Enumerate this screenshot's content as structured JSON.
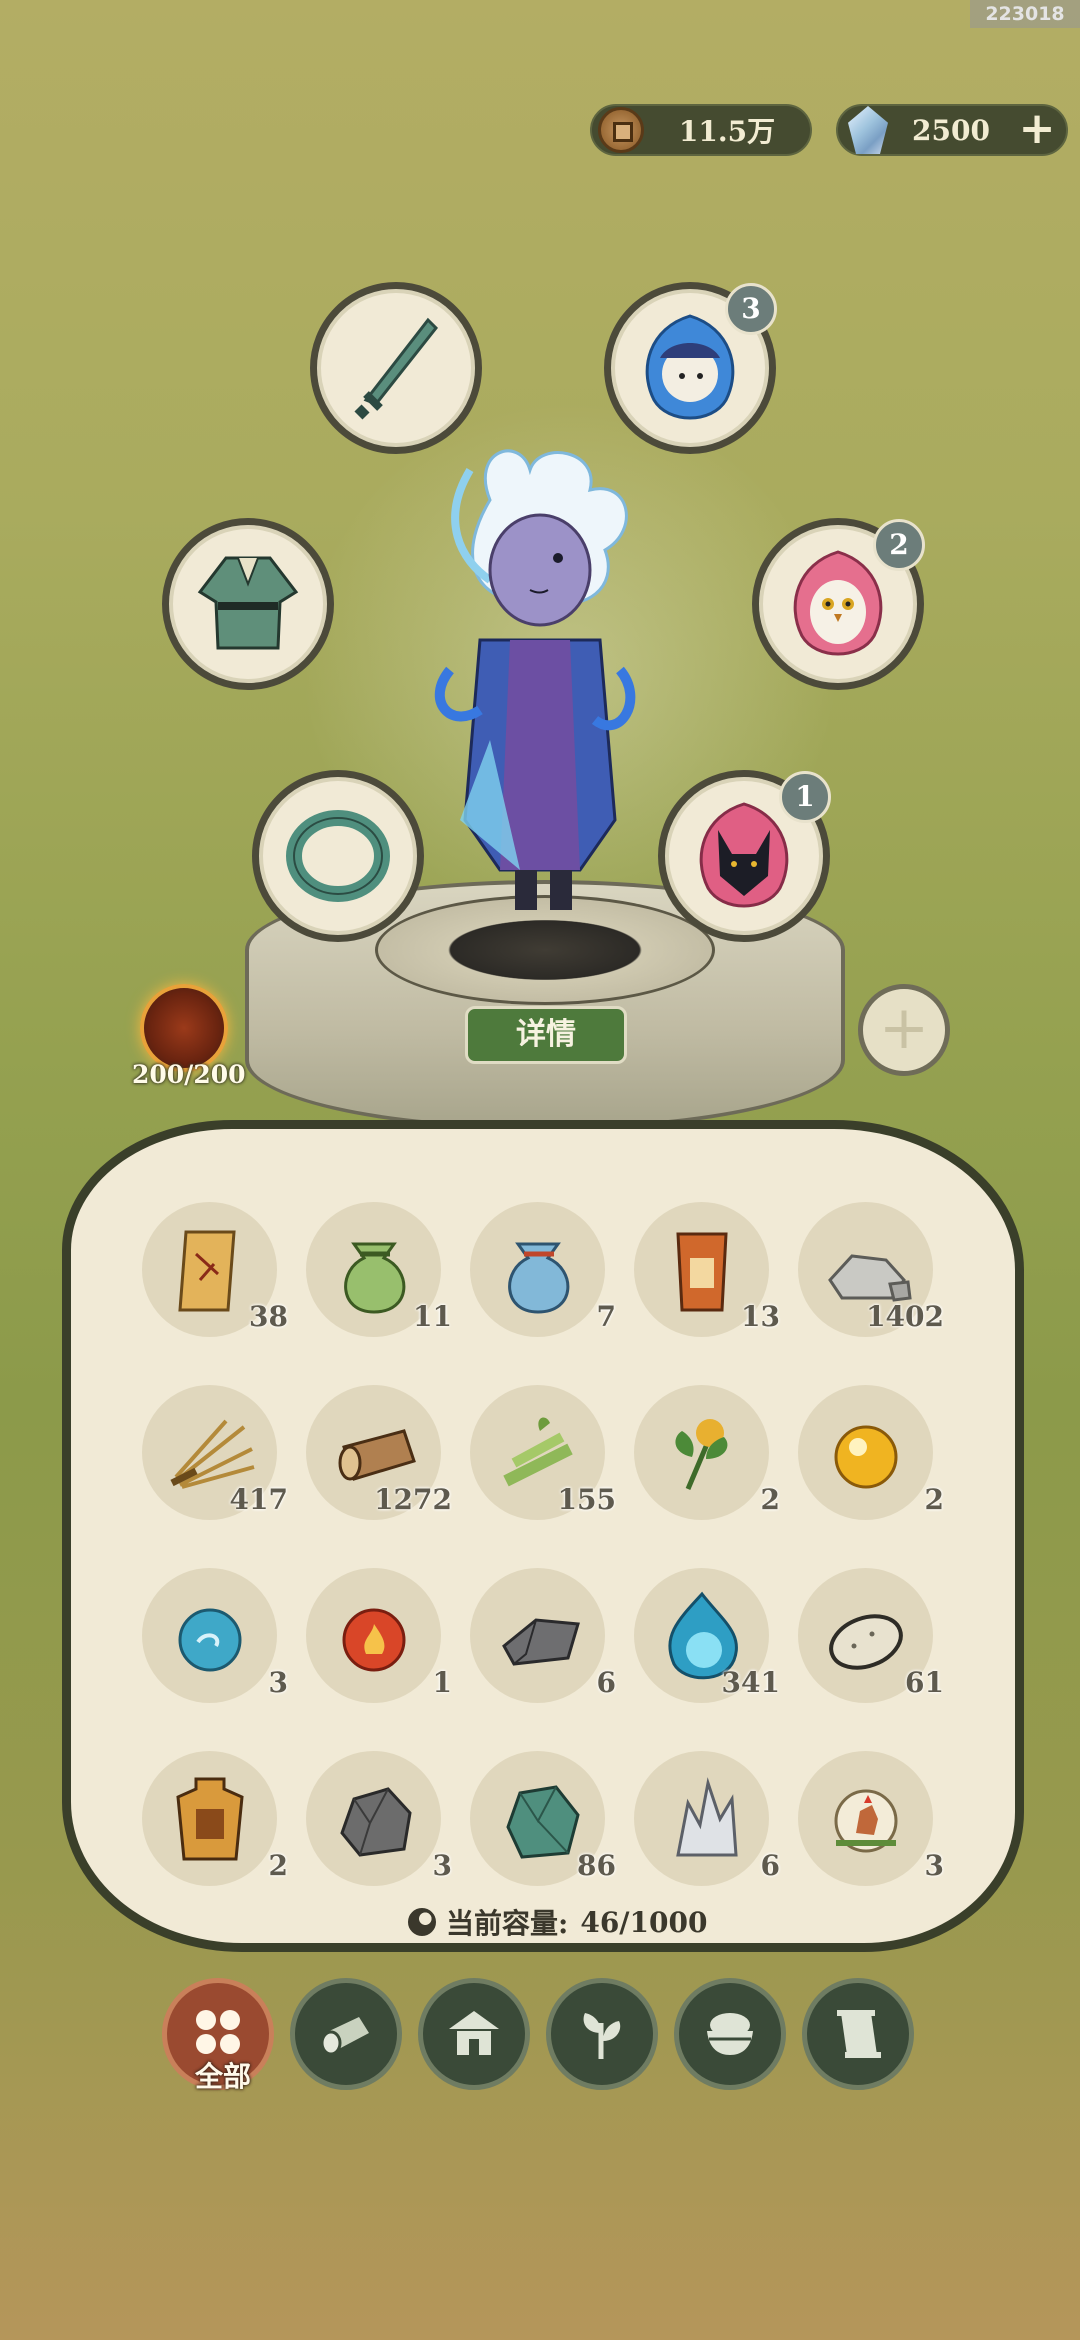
{
  "build_tag": "223018",
  "currency": {
    "coins": {
      "icon": "copper-coin-icon",
      "value": "11.5万"
    },
    "gems": {
      "icon": "spirit-crystal-icon",
      "value": "2500"
    },
    "add_icon": "plus-icon"
  },
  "character": {
    "equip_slots": [
      {
        "name": "sword-slot",
        "icon": "sword-icon"
      },
      {
        "name": "robe-slot",
        "icon": "robe-icon"
      },
      {
        "name": "ring-slot",
        "icon": "jade-bracelet-icon"
      },
      {
        "name": "spirit-pet-blue",
        "icon": "blue-spirit-icon",
        "badge": "3"
      },
      {
        "name": "spirit-pet-owl",
        "icon": "owl-spirit-icon",
        "badge": "2"
      },
      {
        "name": "spirit-pet-jackal",
        "icon": "jackal-spirit-icon",
        "badge": "1"
      }
    ],
    "detail_button": "详情",
    "stamina": "200/200",
    "add_slot_icon": "plus-icon"
  },
  "bag": {
    "items": [
      {
        "icon": "scroll-icon",
        "count": "38"
      },
      {
        "icon": "green-pouch-icon",
        "count": "11"
      },
      {
        "icon": "blue-pouch-icon",
        "count": "7"
      },
      {
        "icon": "token-plaque-icon",
        "count": "13"
      },
      {
        "icon": "stone-icon",
        "count": "1402"
      },
      {
        "icon": "straw-icon",
        "count": "417"
      },
      {
        "icon": "log-icon",
        "count": "1272"
      },
      {
        "icon": "bamboo-icon",
        "count": "155"
      },
      {
        "icon": "herb-flower-icon",
        "count": "2"
      },
      {
        "icon": "gold-orb-icon",
        "count": "2"
      },
      {
        "icon": "water-orb-icon",
        "count": "3"
      },
      {
        "icon": "fire-orb-icon",
        "count": "1"
      },
      {
        "icon": "iron-ingot-icon",
        "count": "6"
      },
      {
        "icon": "spirit-flame-icon",
        "count": "341"
      },
      {
        "icon": "egg-icon",
        "count": "61"
      },
      {
        "icon": "lantern-plaque-icon",
        "count": "2"
      },
      {
        "icon": "ore-rock-icon",
        "count": "3"
      },
      {
        "icon": "jade-ore-icon",
        "count": "86"
      },
      {
        "icon": "crystal-icon",
        "count": "6"
      },
      {
        "icon": "rooster-token-icon",
        "count": "3"
      }
    ],
    "capacity_label": "当前容量:",
    "capacity_value": "46/1000"
  },
  "tabs": [
    {
      "name": "tab-all",
      "icon": "grid-dots-icon",
      "label": "全部",
      "active": true
    },
    {
      "name": "tab-materials",
      "icon": "log-icon"
    },
    {
      "name": "tab-building",
      "icon": "house-icon"
    },
    {
      "name": "tab-herbs",
      "icon": "leaf-icon"
    },
    {
      "name": "tab-food",
      "icon": "rice-bowl-icon"
    },
    {
      "name": "tab-scrolls",
      "icon": "scroll-icon"
    }
  ],
  "colors": {
    "panel": "#f1ead6",
    "panel_border": "#3a3f2a",
    "detail_button": "#4e7a3c",
    "active_tab": "#9a4a30",
    "tab": "#3a4a38"
  }
}
